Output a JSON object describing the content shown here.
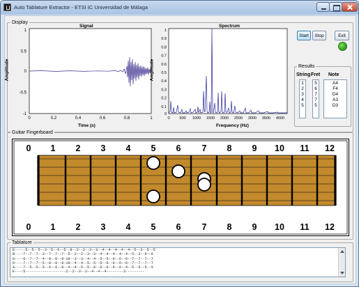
{
  "window": {
    "title": "Auto Tablature Extractor - ETSI IC Universidad de Málaga"
  },
  "display": {
    "label": "Display",
    "signal": {
      "title": "Signal",
      "xlabel": "Time (s)",
      "ylabel": "Amplitude",
      "xticks": [
        "0",
        "0.2",
        "0.4",
        "0.6",
        "0.8",
        "1"
      ],
      "yticks": [
        "1",
        "0.5",
        "0",
        "-0.5",
        "-1"
      ]
    },
    "spectrum": {
      "title": "Spectrum",
      "xlabel": "Frequency (Hz)",
      "ylabel": "Amplitude",
      "xticks": [
        "0",
        "500",
        "1000",
        "1500",
        "2000",
        "2500",
        "3000",
        "3500",
        "4000"
      ],
      "yticks": [
        "1",
        "0.9",
        "0.8",
        "0.7",
        "0.6",
        "0.5",
        "0.4",
        "0.3",
        "0.2",
        "0.1",
        "0"
      ]
    }
  },
  "controls": {
    "start_label": "Start",
    "stop_label": "Stop",
    "exit_label": "Exit",
    "indicator_color": "#3dbb28"
  },
  "results": {
    "label": "Results",
    "string_header": "String",
    "fret_header": "Fret",
    "note_header": "Note",
    "strings": [
      "1",
      "2",
      "3",
      "4",
      "5"
    ],
    "frets": [
      "5",
      "6",
      "7",
      "7",
      "5"
    ],
    "notes": [
      "A4",
      "F4",
      "D4",
      "A3",
      "D3"
    ]
  },
  "fingerboard": {
    "label": "Guitar Fingerboard",
    "fret_numbers": [
      "0",
      "1",
      "2",
      "3",
      "4",
      "5",
      "6",
      "7",
      "8",
      "9",
      "10",
      "11",
      "12"
    ],
    "wood_color": "#c28a2c",
    "markers": [
      {
        "string": 1,
        "fret": 5
      },
      {
        "string": 2,
        "fret": 6
      },
      {
        "string": 3,
        "fret": 7
      },
      {
        "string": 4,
        "fret": 7
      },
      {
        "string": 5,
        "fret": 5
      }
    ]
  },
  "tablature": {
    "label": "Tablature",
    "lines": [
      "E-----5--5--5--3--5--6--5--8--2--2--3--3--4--4--4--4--4--5--3--5--5",
      "B----7--7--7--3--7--7--7--5--2--2--3--3--4--4--4--4--4--5--3--6--6",
      "G----6--7--7--4--8--8--8-10--3--3--4--4--5--5--6--6--6--7--7--7--7",
      "D----7--7--7--5--8--8--8-10--4--4--5--5--6--6--6--6--6--7--7--7--7",
      "A----7--5--5--5--6--6--8--4--4--5--5--6--6--6--6--6--4--5--5--5--5",
      "E----5-------------------2--2--3--3--4--4--4--------3---------"
    ]
  }
}
